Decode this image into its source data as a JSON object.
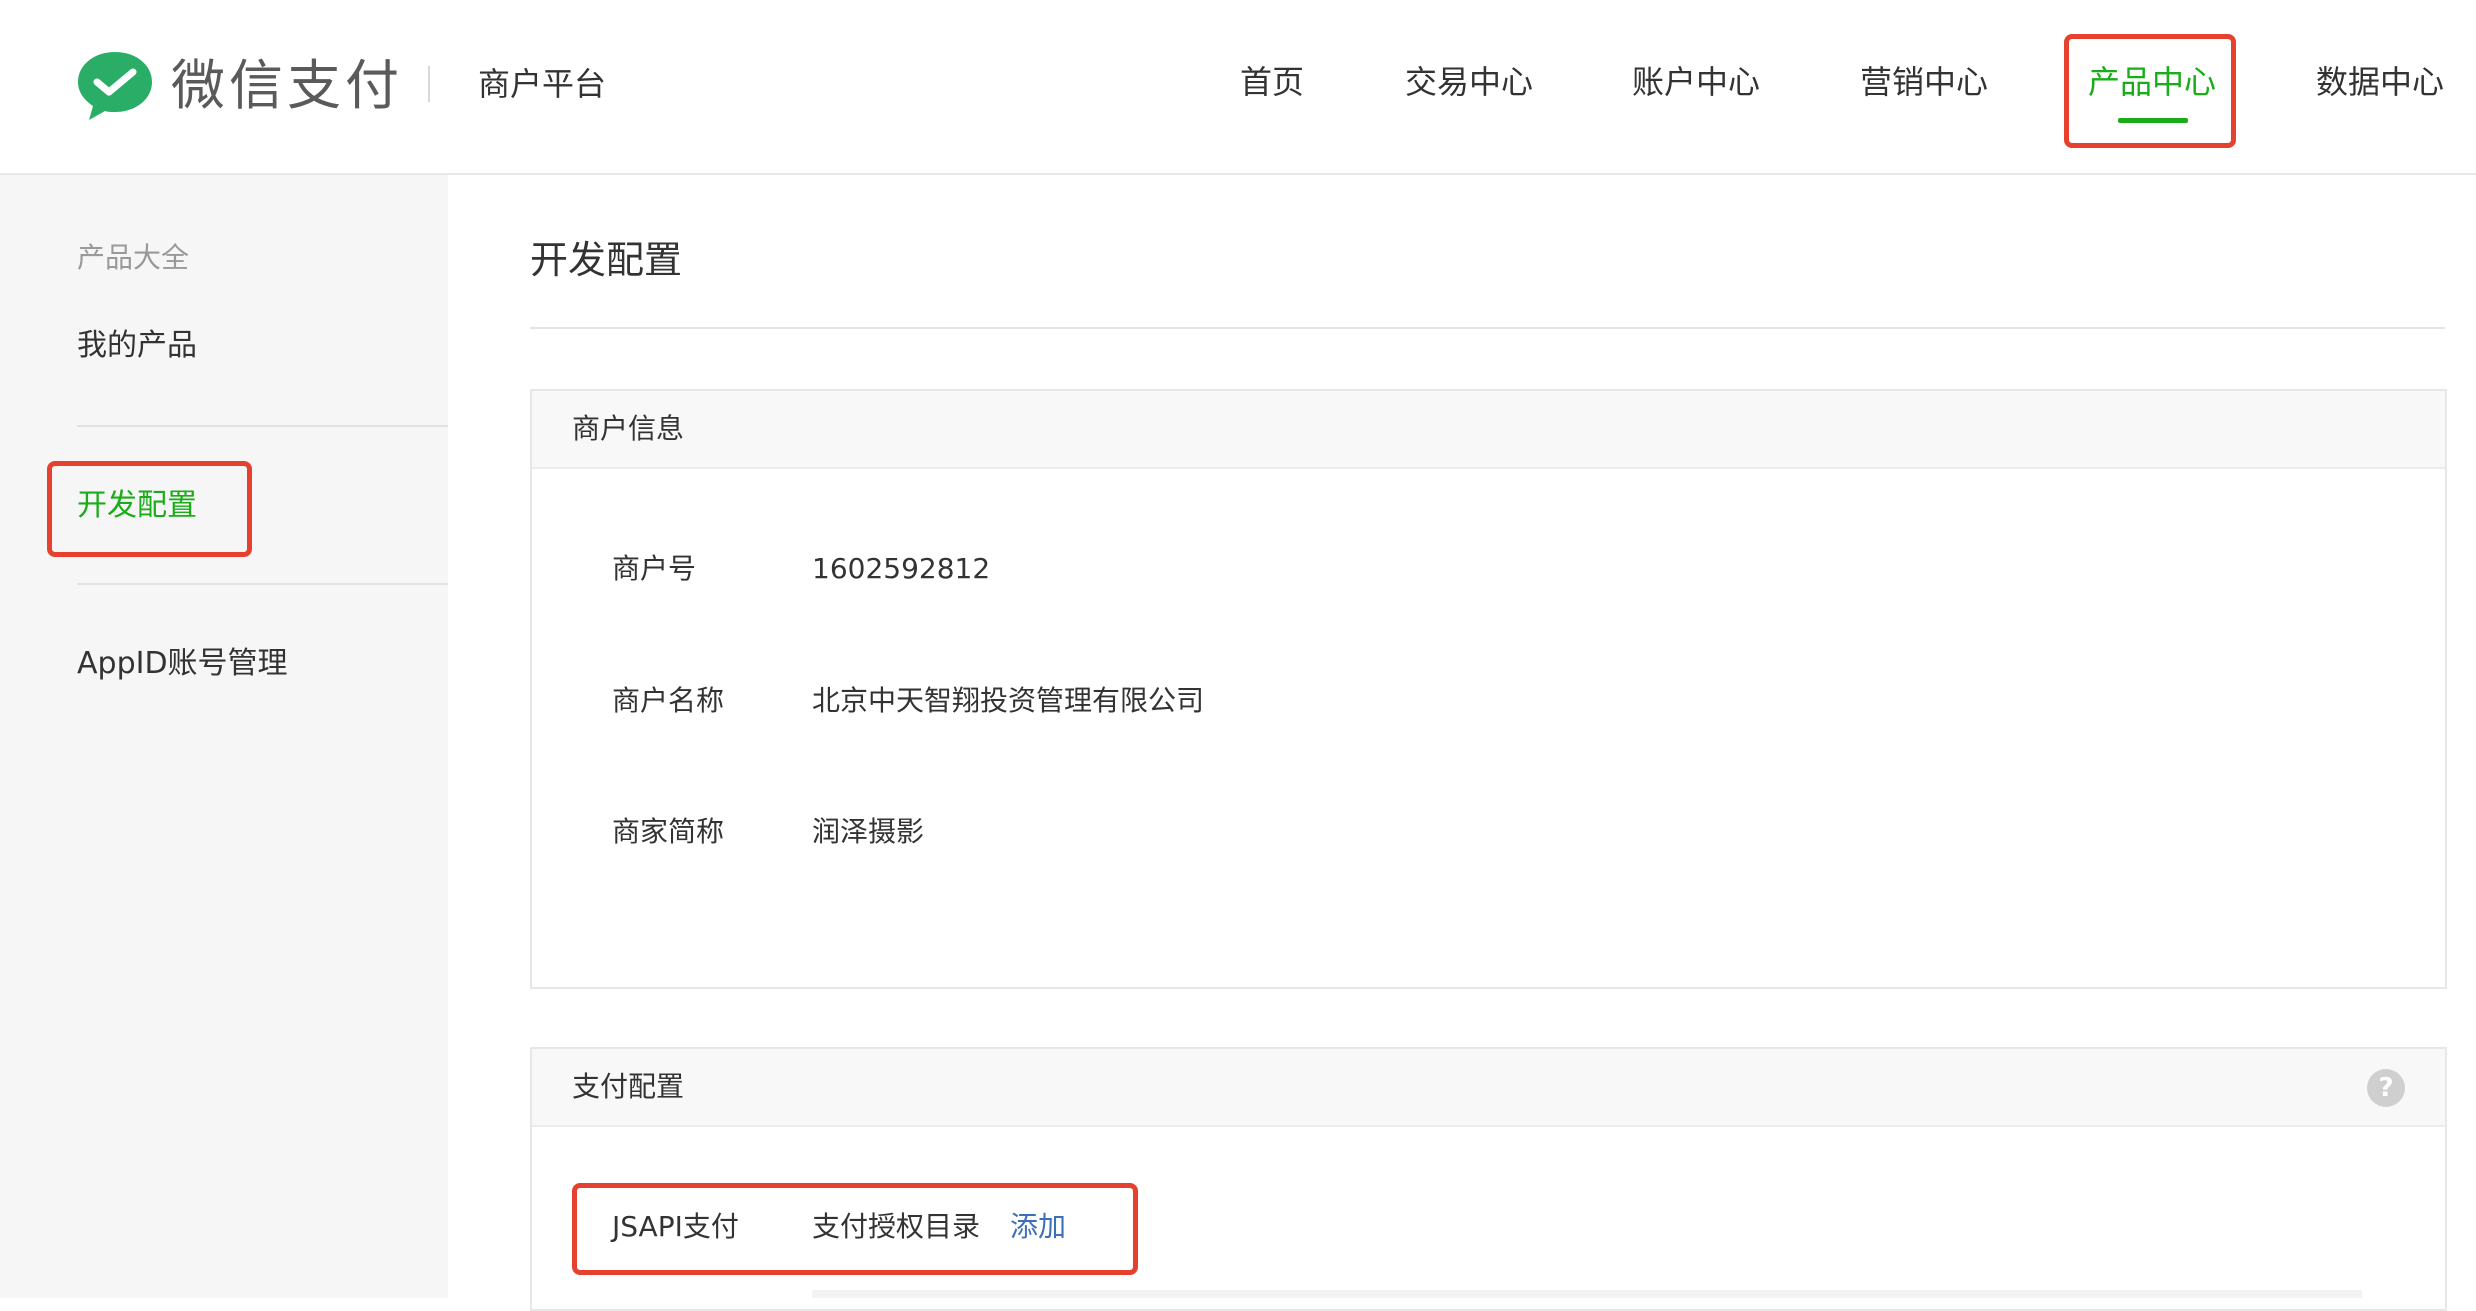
{
  "header": {
    "logo_text": "微信支付",
    "platform": "商户平台",
    "nav": [
      "首页",
      "交易中心",
      "账户中心",
      "营销中心",
      "产品中心",
      "数据中心"
    ],
    "active_nav": "产品中心",
    "accent_color": "#1aad19"
  },
  "sidebar": {
    "group_label": "产品大全",
    "items": [
      "我的产品",
      "开发配置",
      "AppID账号管理"
    ],
    "active_item": "开发配置"
  },
  "main": {
    "page_title": "开发配置",
    "merchant_info": {
      "title": "商户信息",
      "rows": [
        {
          "label": "商户号",
          "value": "1602592812"
        },
        {
          "label": "商户名称",
          "value": "北京中天智翔投资管理有限公司"
        },
        {
          "label": "商家简称",
          "value": "润泽摄影"
        }
      ]
    },
    "payment_config": {
      "title": "支付配置",
      "help_icon": "question-circle-icon",
      "help_glyph": "?",
      "row": {
        "label": "JSAPI支付",
        "field": "支付授权目录",
        "action": "添加"
      }
    }
  },
  "annotation_color": "#e5412e"
}
